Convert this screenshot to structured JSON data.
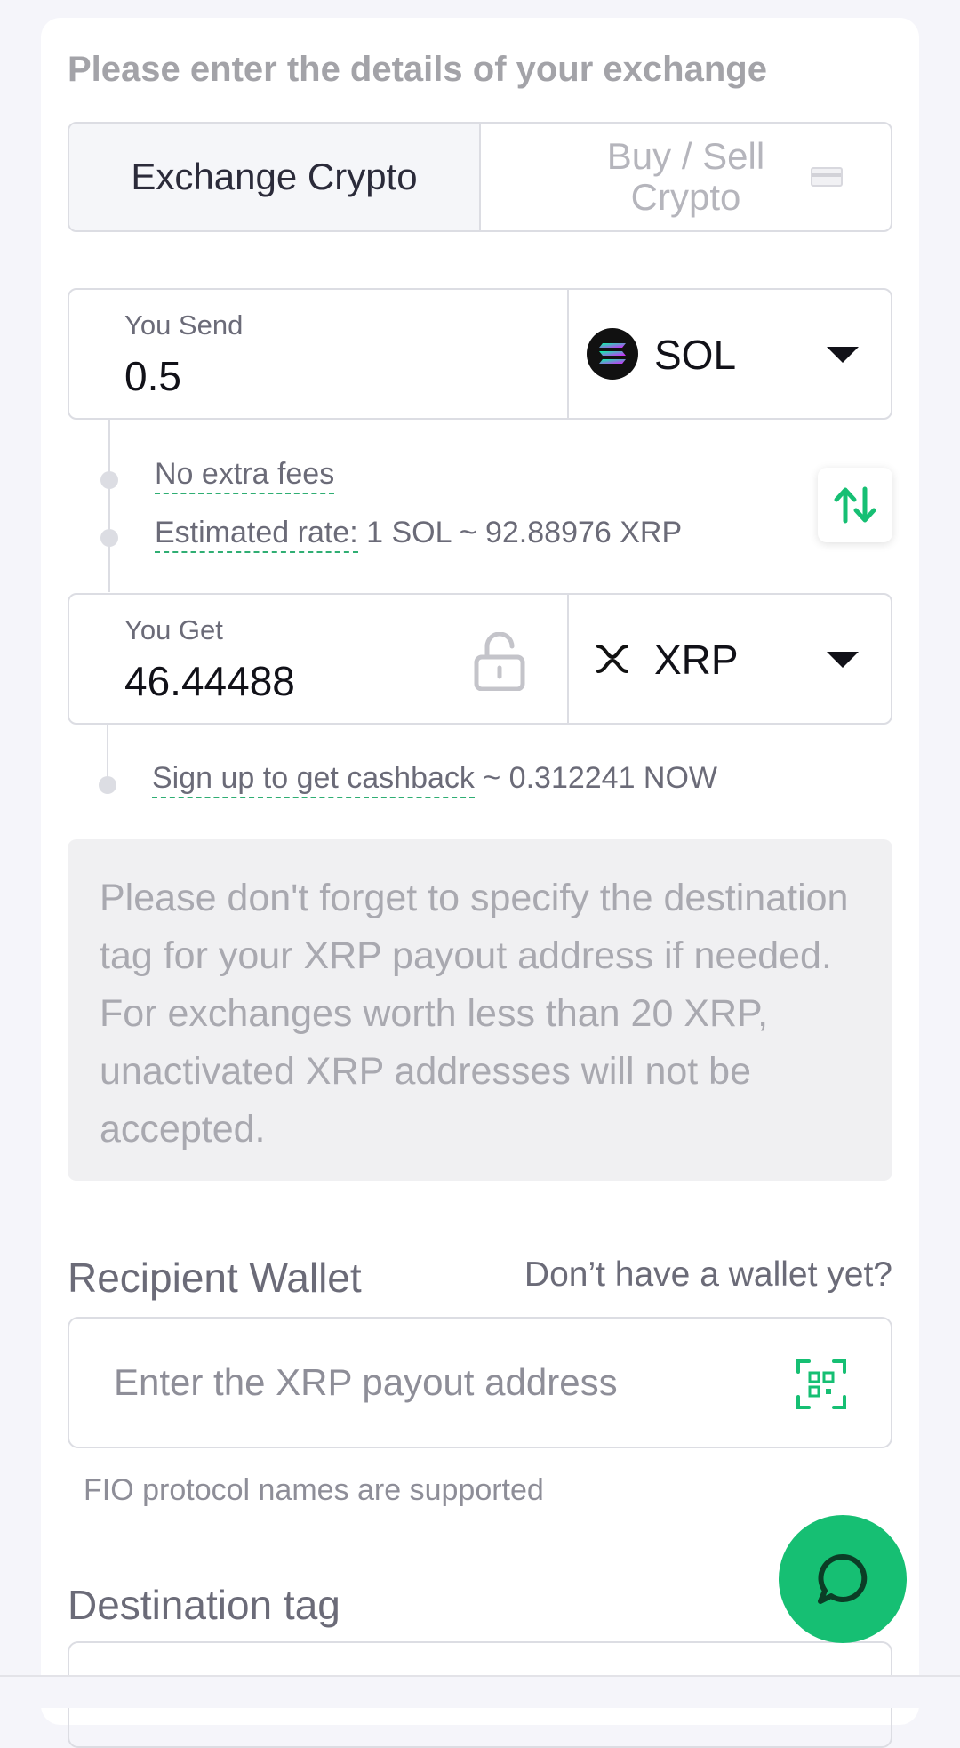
{
  "form": {
    "heading": "Please enter the details of your exchange",
    "modes": [
      {
        "label": "Exchange Crypto",
        "active": true
      },
      {
        "label": "Buy / Sell Crypto",
        "active": false
      }
    ]
  },
  "send": {
    "label": "You Send",
    "amount": "0.5",
    "currency": "SOL",
    "currency_icon": "solana-icon"
  },
  "fees": {
    "no_fees": "No extra fees",
    "rate_label": "Estimated rate:",
    "rate_value": "1 SOL ~ 92.88976 XRP"
  },
  "get": {
    "label": "You Get",
    "amount": "46.44488",
    "currency": "XRP",
    "currency_icon": "xrp-icon"
  },
  "cashback": {
    "link": "Sign up to get cashback",
    "value": "~ 0.312241 NOW"
  },
  "notice": "Please don't forget to specify the destination tag for your XRP payout address if needed. For exchanges worth less than 20 XRP, unactivated XRP addresses will not be accepted.",
  "wallet": {
    "title": "Recipient Wallet",
    "no_wallet_link": "Don’t have a wallet yet?",
    "placeholder": "Enter the XRP payout address",
    "hint": "FIO protocol names are supported"
  },
  "destination_tag": {
    "title": "Destination tag"
  },
  "colors": {
    "accent": "#16bf73",
    "dashed_underline": "#2fae73"
  }
}
